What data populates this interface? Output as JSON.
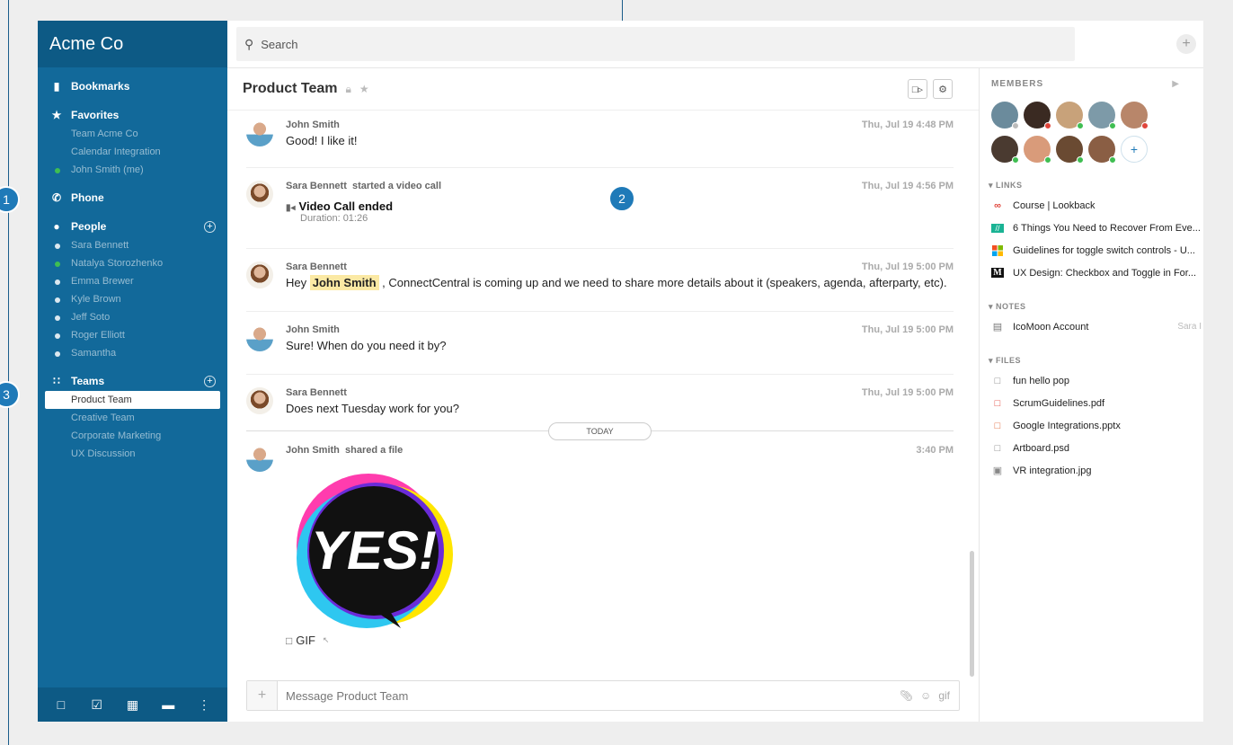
{
  "sidebar": {
    "brand": "Acme Co",
    "bookmarks_label": "Bookmarks",
    "favorites_label": "Favorites",
    "favorites": [
      "Team Acme Co",
      "Calendar Integration",
      "John Smith (me)"
    ],
    "phone_label": "Phone",
    "people_label": "People",
    "people": [
      "Sara Bennett",
      "Natalya Storozhenko",
      "Emma Brewer",
      "Kyle Brown",
      "Jeff Soto",
      "Roger Elliott",
      "Samantha"
    ],
    "teams_label": "Teams",
    "teams": [
      "Product Team",
      "Creative Team",
      "Corporate Marketing",
      "UX Discussion"
    ]
  },
  "search": {
    "placeholder": "Search"
  },
  "chat": {
    "title": "Product Team",
    "messages": [
      {
        "author": "John Smith",
        "text": "Good! I like it!",
        "time": "Thu, Jul 19 4:48 PM"
      },
      {
        "author": "Sara Bennett",
        "action": "started a video call",
        "call_title": "Video Call ended",
        "call_duration": "Duration: 01:26",
        "time": "Thu, Jul 19 4:56 PM"
      },
      {
        "author": "Sara Bennett",
        "text_pre": "Hey ",
        "mention": "John Smith",
        "text_post": " , ConnectCentral is coming up and we need to share more details about it (speakers, agenda, afterparty, etc).",
        "time": "Thu, Jul 19 5:00 PM"
      },
      {
        "author": "John Smith",
        "text": "Sure! When do you need it by?",
        "time": "Thu, Jul 19 5:00 PM"
      },
      {
        "author": "Sara Bennett",
        "text": "Does next Tuesday work for you?",
        "time": "Thu, Jul 19 5:00 PM"
      },
      {
        "author": "John Smith",
        "action": "shared a file",
        "time": "3:40 PM",
        "gif_text": "YES!",
        "file_label": "GIF"
      }
    ],
    "today_label": "TODAY",
    "composer_placeholder": "Message Product Team",
    "gif_label": "gif"
  },
  "panel": {
    "members_title": "MEMBERS",
    "links_title": "LINKS",
    "links": [
      "Course | Lookback",
      "6 Things You Need to Recover From Eve...",
      "Guidelines for toggle switch controls - U...",
      "UX Design: Checkbox and Toggle in For..."
    ],
    "notes_title": "NOTES",
    "notes": [
      {
        "title": "IcoMoon Account",
        "by": "Sara I"
      }
    ],
    "files_title": "FILES",
    "files": [
      "fun hello pop",
      "ScrumGuidelines.pdf",
      "Google Integrations.pptx",
      "Artboard.psd",
      "VR integration.jpg"
    ]
  },
  "callouts": [
    "1",
    "2",
    "3"
  ],
  "colors": {
    "sidebar": "#12699a",
    "sidebar_dark": "#0d5a85",
    "online": "#3fbe52",
    "busy": "#e0443a",
    "callout": "#1f7ab8"
  }
}
